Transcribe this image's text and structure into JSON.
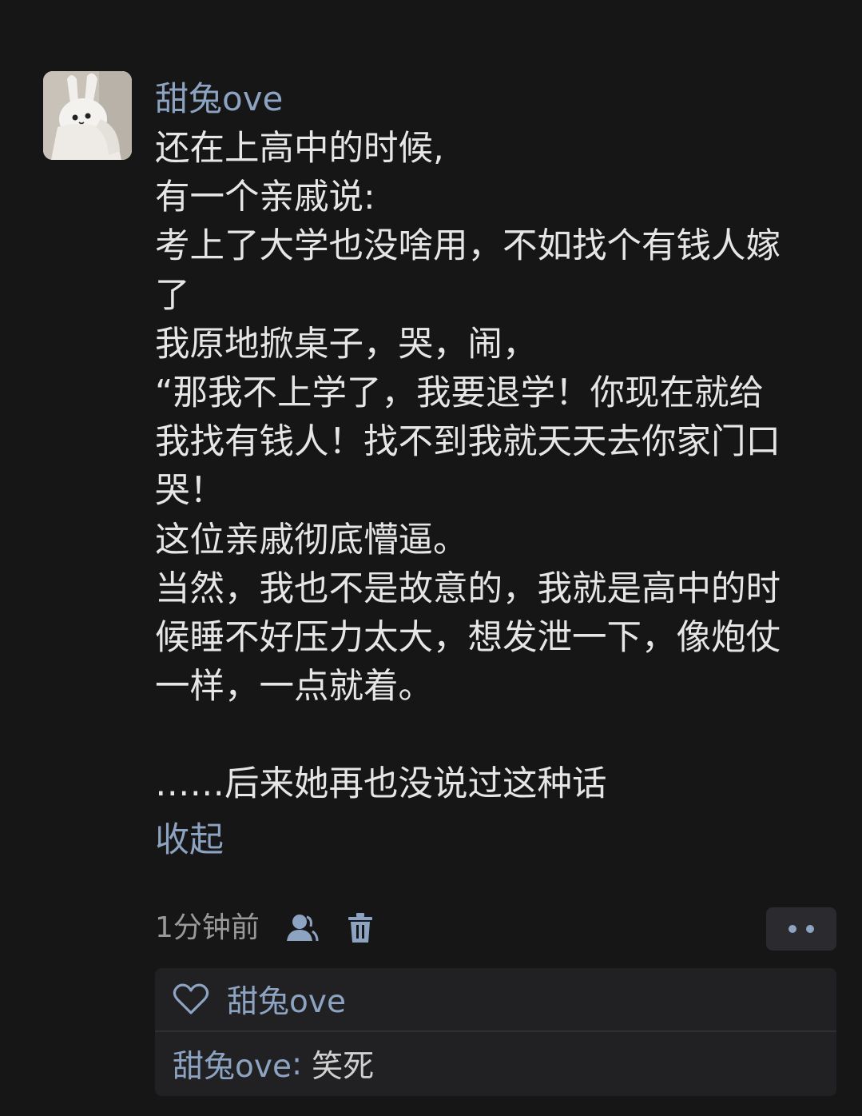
{
  "post": {
    "username": "甜兔ove",
    "lines": [
      "还在上高中的时候,",
      "有一个亲戚说:",
      "考上了大学也没啥用，不如找个有钱人嫁",
      "了",
      "我原地掀桌子，哭，闹，",
      "“那我不上学了，我要退学！你现在就给",
      "我找有钱人！找不到我就天天去你家门口",
      "哭！",
      "这位亲戚彻底懵逼。",
      "当然，我也不是故意的，我就是高中的时",
      "候睡不好压力太大，想发泄一下，像炮仗",
      "一样，一点就着。",
      "",
      "……后来她再也没说过这种话"
    ],
    "collapse_label": "收起"
  },
  "meta": {
    "time": "1分钟前",
    "icons": [
      "user-icon",
      "trash-icon",
      "more-icon"
    ]
  },
  "reactions": {
    "liker": "甜兔ove",
    "comment": {
      "user": "甜兔ove",
      "separator": ":",
      "text": "笑死"
    }
  },
  "colors": {
    "background": "#161616",
    "link": "#8da3c2",
    "text": "#e6e6e6",
    "muted": "#9a9a9a",
    "panel": "#212123"
  }
}
